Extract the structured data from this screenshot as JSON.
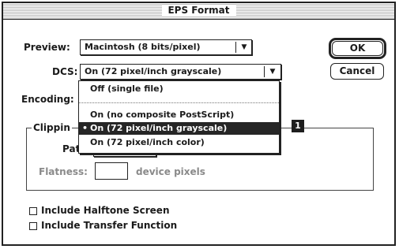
{
  "dialog": {
    "title": "EPS Format"
  },
  "preview": {
    "label": "Preview:",
    "value": "Macintosh (8 bits/pixel)"
  },
  "dcs": {
    "label": "DCS:",
    "value": "On (72 pixel/inch grayscale)",
    "options": [
      "Off (single file)",
      "On (no composite PostScript)",
      "On (72 pixel/inch grayscale)",
      "On (72 pixel/inch color)"
    ],
    "selected_index": 2,
    "selected_bullet": "•"
  },
  "encoding": {
    "label": "Encoding:"
  },
  "clipping": {
    "group_label": "Clippin",
    "path_label": "Pat",
    "flatness_label": "Flatness:",
    "flatness_value": "",
    "flatness_unit": "device pixels"
  },
  "options": {
    "halftone": {
      "label": "Include Halftone Screen",
      "checked": false
    },
    "transfer": {
      "label": "Include Transfer Function",
      "checked": false
    }
  },
  "buttons": {
    "ok": "OK",
    "cancel": "Cancel"
  },
  "callout": {
    "number": "1"
  }
}
